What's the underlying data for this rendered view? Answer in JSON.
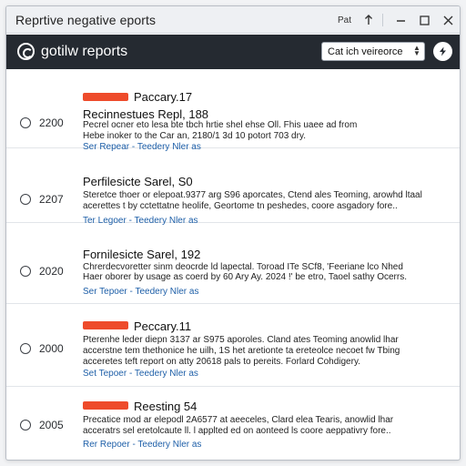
{
  "window": {
    "title": "Reprtive negative eports",
    "label": "Pat"
  },
  "app": {
    "title": "gotilw reports",
    "select": {
      "value": "Cat ich veireorce"
    }
  },
  "rows": [
    {
      "number": "2200",
      "tag": "Paccary.17",
      "subtitle": "Recinnestues Repl, 188",
      "desc1": "Pecrel ocner eto lesa bte tbch hrtie shel ehse Oll. Fhis uaee ad from",
      "desc2": "Hebe inoker to the Car an, 2180/1 3d 10 potort 703 dry.",
      "link": "Ser Repear - Teedery Nler as"
    },
    {
      "number": "2207",
      "title": "Perfilesicte Sarel, S0",
      "desc1": "Steretce thoer or elepoat.9377 arg S96 aporcates, Ctend ales Teoming, arowhd ltaal",
      "desc2": "acerettes t by cctettatne heolife,   Geortome tn peshedes, coore asgadory fore..",
      "link": "Ter Legoer - Teedery Nler as"
    },
    {
      "number": "2020",
      "title": "Fornilesicte Sarel, 192",
      "desc1": "Chrerdecvoretter sinm deocrde ld lapectal. Toroad ITe SCf8, 'Feeriane lco Nhed",
      "desc2": "Haer oborer by usage as coerd by 60 Ary Ay. 2024 !' be etro, Taoel sathy Ocerrs.",
      "link": "Ser Tepoer - Teedery Nler as"
    },
    {
      "number": "2000",
      "tag": "Peccary.11",
      "desc1": "Pterenhe leder diepn 3137 ar S975 aporoles. Cland ates Teoming anowlid lhar",
      "desc2": "accerstne tem thethonice he uilh, 1S het aretionte ta ereteolce necoet fw Tbing",
      "desc3": "acceretes teft report on atty 20618 pals to pereits. Forlard Cohdigery.",
      "link": "Set Tepoer - Teedery Nler as"
    },
    {
      "number": "2005",
      "tag": "Reesting 54",
      "desc1": "Precatice mod ar elepodl 2A6577 at aeeceles, Clard elea Tearis, anowlid lhar",
      "desc2": "acceratrs sel eretolcaute ll. l applted ed on aonteed ls coore aeppativry fore..",
      "link": "Rer Repoer - Teedery Nler as"
    }
  ],
  "colors": {
    "appbar": "#252a31",
    "tag": "#ee4b2b",
    "link": "#1e5fa8"
  }
}
